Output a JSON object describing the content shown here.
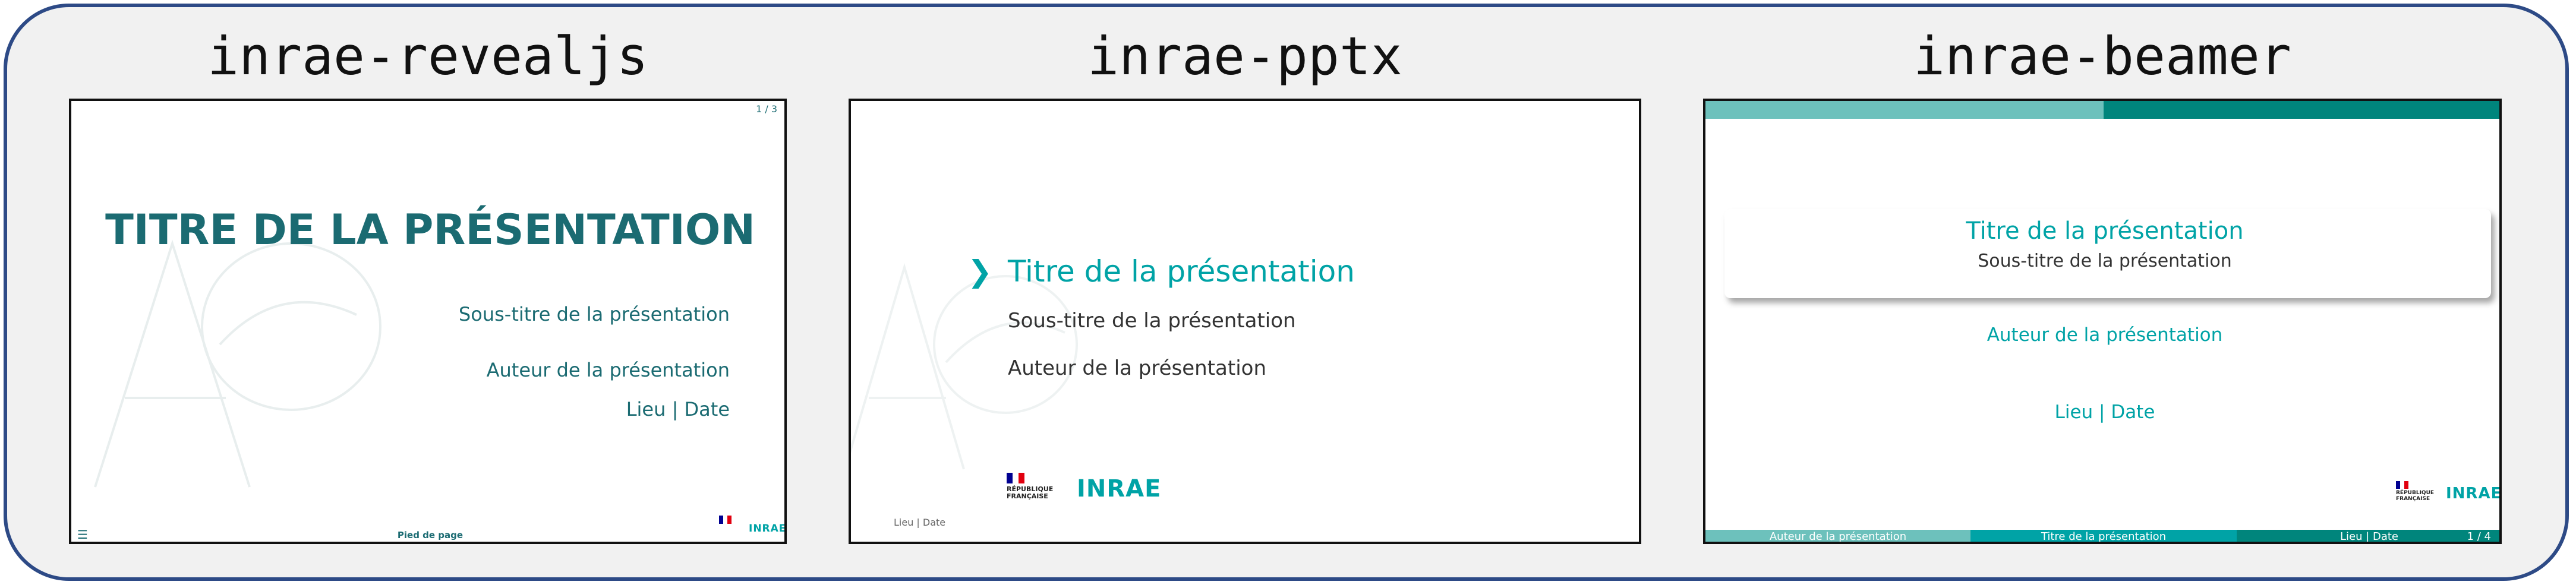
{
  "panels": [
    {
      "name": "inrae-revealjs",
      "slide": {
        "counter": "1 / 3",
        "title": "TITRE DE LA PRÉSENTATION",
        "subtitle": "Sous-titre de la présentation",
        "author": "Auteur de la présentation",
        "place_date": "Lieu | Date",
        "footer": "Pied de page",
        "menu_icon": "hamburger-menu-icon",
        "logo": "INRAE",
        "colors": {
          "title": "#1b6b72",
          "text": "#1b6b72"
        }
      }
    },
    {
      "name": "inrae-pptx",
      "slide": {
        "title": "Titre de la présentation",
        "subtitle": "Sous-titre de la présentation",
        "author": "Auteur de la présentation",
        "place_date": "Lieu | Date",
        "logo": "INRAE",
        "rf_line1": "RÉPUBLIQUE",
        "rf_line2": "FRANÇAISE",
        "arrow_icon": "chevron-right-icon",
        "colors": {
          "title": "#00a3a6",
          "text": "#333333"
        }
      }
    },
    {
      "name": "inrae-beamer",
      "slide": {
        "title": "Titre de la présentation",
        "subtitle": "Sous-titre de la présentation",
        "author": "Auteur de la présentation",
        "place_date": "Lieu | Date",
        "footer_author": "Auteur de la présentation",
        "footer_title": "Titre de la présentation",
        "footer_place": "Lieu | Date",
        "footer_page": "1 / 4",
        "logo": "INRAE",
        "rf_line1": "RÉPUBLIQUE",
        "rf_line2": "FRANÇAISE",
        "colors": {
          "title": "#00a3a6",
          "bar_light": "#6dc1bc",
          "bar_dark": "#00857c"
        }
      }
    }
  ]
}
